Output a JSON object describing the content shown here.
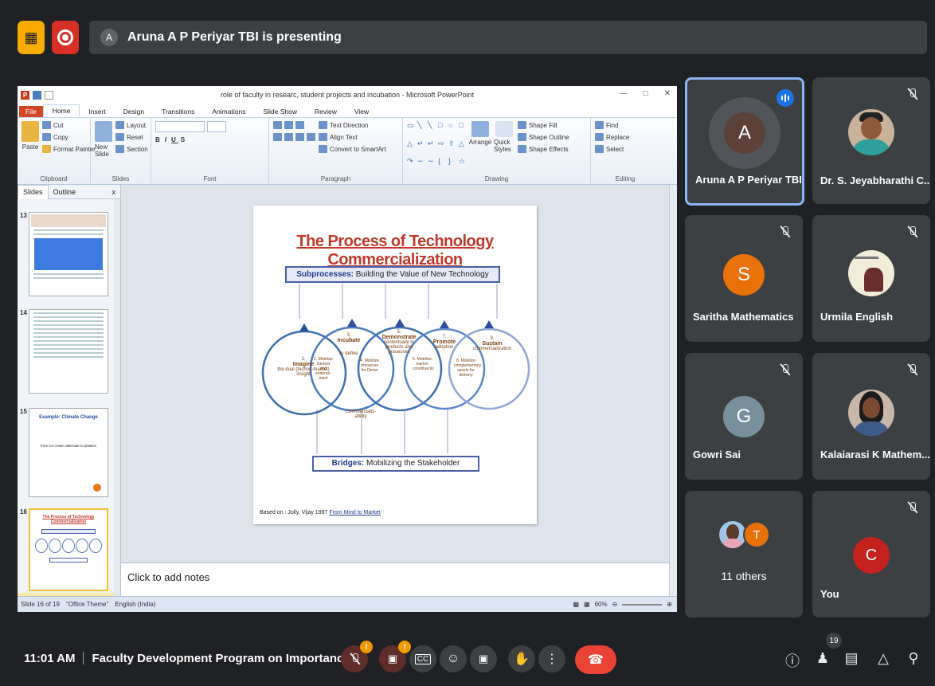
{
  "topbar": {
    "presenter_initial": "A",
    "presenting_text": "Aruna A P Periyar TBI is presenting"
  },
  "ppt": {
    "window_title": "role of faculty in researc, student projects and incubation - Microsoft PowerPoint",
    "tabs": [
      "File",
      "Home",
      "Insert",
      "Design",
      "Transitions",
      "Animations",
      "Slide Show",
      "Review",
      "View"
    ],
    "active_tab": "Home",
    "ribbon": {
      "clipboard": {
        "paste": "Paste",
        "cut": "Cut",
        "copy": "Copy",
        "format_painter": "Format Painter",
        "group": "Clipboard"
      },
      "slides": {
        "new_slide": "New Slide",
        "layout": "Layout",
        "reset": "Reset",
        "section": "Section",
        "group": "Slides"
      },
      "font": {
        "group": "Font"
      },
      "paragraph": {
        "text_direction": "Text Direction",
        "align_text": "Align Text",
        "convert": "Convert to SmartArt",
        "group": "Paragraph"
      },
      "drawing": {
        "arrange": "Arrange",
        "quick_styles": "Quick Styles",
        "shape_fill": "Shape Fill",
        "shape_outline": "Shape Outline",
        "shape_effects": "Shape Effects",
        "group": "Drawing"
      },
      "editing": {
        "find": "Find",
        "replace": "Replace",
        "select": "Select",
        "group": "Editing"
      }
    },
    "panel_tabs": {
      "slides": "Slides",
      "outline": "Outline",
      "close": "x"
    },
    "thumbs": [
      {
        "num": "13"
      },
      {
        "num": "14"
      },
      {
        "num": "15",
        "title": "Example: Climate Change",
        "sub": "from ice cream  alternate  to plastics"
      },
      {
        "num": "16",
        "title": "The Process of Technology Commercialization"
      }
    ],
    "slide": {
      "title": "The Process of Technology Commercialization",
      "subprocesses_label": "Subprocesses:",
      "subprocesses_text": "Building the Value of New Technology",
      "bridges_label": "Bridges:",
      "bridges_text": "Mobilizing the Stakeholder",
      "based_on": "Based on : Jolly, Vijay 1997",
      "based_link": "From Mind to Market",
      "circles": [
        {
          "num": "1.",
          "head": "Imagine",
          "body": "the dual (techno-market) insight"
        },
        {
          "num": "3.",
          "head": "Incubate",
          "body": "to define"
        },
        {
          "num": "5.",
          "head": "Demonstrate",
          "body": "contextually in products and processes"
        },
        {
          "num": "7.",
          "head": "Promote",
          "body": "adoption"
        },
        {
          "num": "9.",
          "head": "Sustain",
          "body": "commercialization"
        }
      ],
      "bridges": [
        {
          "num": "2.",
          "text": "Mobilize interest and endorse-ment"
        },
        {
          "num": "4.",
          "text": "Mobilize resources for Demo"
        },
        {
          "num": "6.",
          "text": "Mobilize market constituents"
        },
        {
          "num": "8.",
          "text": "Mobilize complementary assets for delivery"
        }
      ],
      "commercializability": "Commercializ- ability"
    },
    "notes_placeholder": "Click to add notes",
    "status": {
      "slide_of": "Slide 16 of 19",
      "theme": "\"Office Theme\"",
      "lang": "English (India)",
      "zoom": "60%"
    }
  },
  "tiles": [
    {
      "name": "Aruna A P Periyar TBI",
      "initial": "A",
      "color": "#5d4037",
      "speaking": true
    },
    {
      "name": "Dr. S. Jeyabharathi C..."
    },
    {
      "name": "Saritha Mathematics",
      "initial": "S",
      "color": "#e8710a"
    },
    {
      "name": "Urmila English"
    },
    {
      "name": "Gowri Sai",
      "initial": "G",
      "color": "#78909c"
    },
    {
      "name": "Kalaiarasi K Mathem..."
    },
    {
      "name": "11 others",
      "initial": "T",
      "color": "#e8710a"
    },
    {
      "name": "You",
      "initial": "C",
      "color": "#c5221f"
    }
  ],
  "bottombar": {
    "time": "11:01 AM",
    "meeting_title": "Faculty Development Program on Importance...",
    "warn_glyph": "!",
    "participant_count": "19"
  }
}
